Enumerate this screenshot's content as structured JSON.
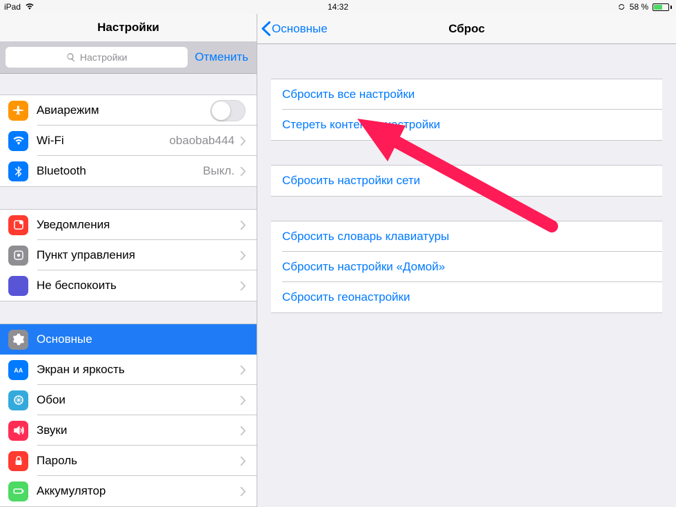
{
  "statusbar": {
    "device": "iPad",
    "time": "14:32",
    "battery_text": "58 %",
    "battery_pct": 58
  },
  "left": {
    "title": "Настройки",
    "search_placeholder": "Настройки",
    "cancel": "Отменить",
    "groups": [
      {
        "items": [
          {
            "icon": "airplane",
            "label": "Авиарежим",
            "type": "switch",
            "on": false
          },
          {
            "icon": "wifi",
            "label": "Wi-Fi",
            "type": "detail",
            "value": "obaobab444"
          },
          {
            "icon": "bluetooth",
            "label": "Bluetooth",
            "type": "detail",
            "value": "Выкл."
          }
        ]
      },
      {
        "items": [
          {
            "icon": "notif",
            "label": "Уведомления",
            "type": "disclosure"
          },
          {
            "icon": "cc",
            "label": "Пункт управления",
            "type": "disclosure"
          },
          {
            "icon": "dnd",
            "label": "Не беспокоить",
            "type": "disclosure"
          }
        ]
      },
      {
        "items": [
          {
            "icon": "general",
            "label": "Основные",
            "type": "disclosure",
            "selected": true
          },
          {
            "icon": "display",
            "label": "Экран и яркость",
            "type": "disclosure"
          },
          {
            "icon": "wall",
            "label": "Обои",
            "type": "disclosure"
          },
          {
            "icon": "sound",
            "label": "Звуки",
            "type": "disclosure"
          },
          {
            "icon": "pwd",
            "label": "Пароль",
            "type": "disclosure"
          },
          {
            "icon": "batt",
            "label": "Аккумулятор",
            "type": "disclosure"
          }
        ]
      }
    ]
  },
  "right": {
    "back": "Основные",
    "title": "Сброс",
    "groups": [
      [
        "Сбросить все настройки",
        "Стереть контент и настройки"
      ],
      [
        "Сбросить настройки сети"
      ],
      [
        "Сбросить словарь клавиатуры",
        "Сбросить настройки «Домой»",
        "Сбросить геонастройки"
      ]
    ]
  }
}
